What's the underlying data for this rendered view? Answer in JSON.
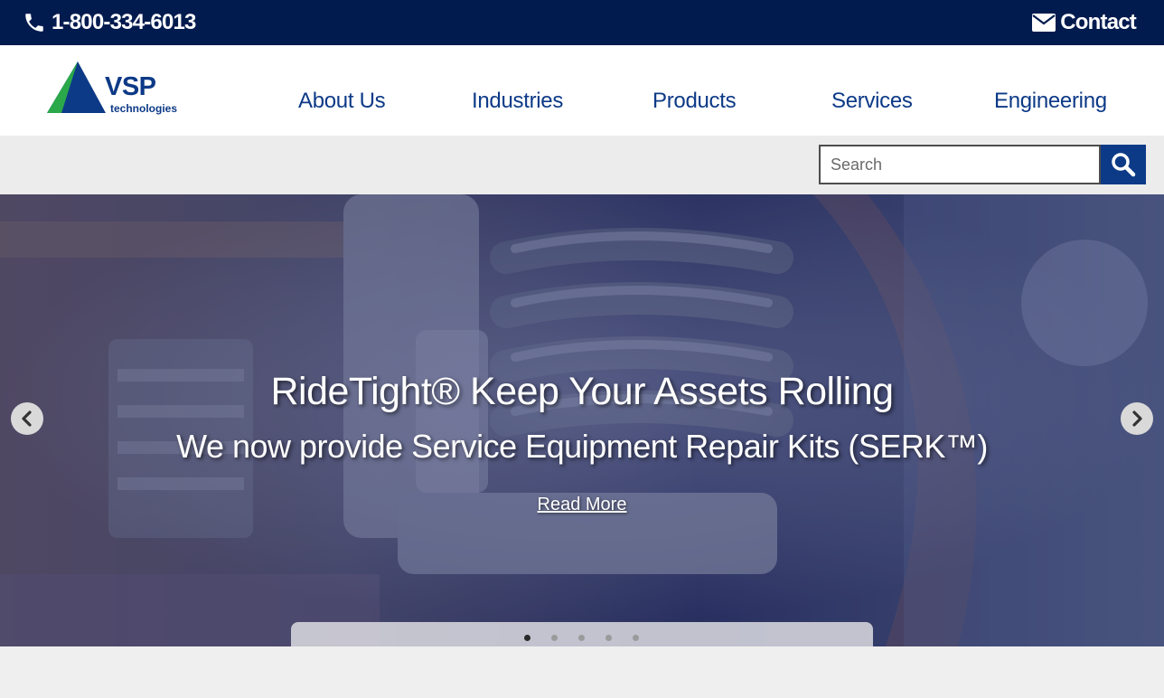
{
  "topbar": {
    "phone": "1-800-334-6013",
    "contact": "Contact",
    "phone_icon": "phone-icon",
    "contact_icon": "envelope-icon",
    "background": "#021b4f"
  },
  "header": {
    "logo": {
      "name": "VSP",
      "tagline": "technologies"
    },
    "nav": [
      {
        "label": "About Us"
      },
      {
        "label": "Industries"
      },
      {
        "label": "Products"
      },
      {
        "label": "Services"
      },
      {
        "label": "Engineering"
      }
    ],
    "nav_color": "#0d3a87"
  },
  "search": {
    "placeholder": "Search",
    "button_icon": "search-icon"
  },
  "hero": {
    "title": "RideTight® Keep Your Assets Rolling",
    "subtitle": "We now provide Service Equipment Repair Kits (SERK™)",
    "link": "Read More",
    "prev_icon": "chevron-left-icon",
    "next_icon": "chevron-right-icon",
    "slides_total": 5,
    "active_slide": 1
  }
}
